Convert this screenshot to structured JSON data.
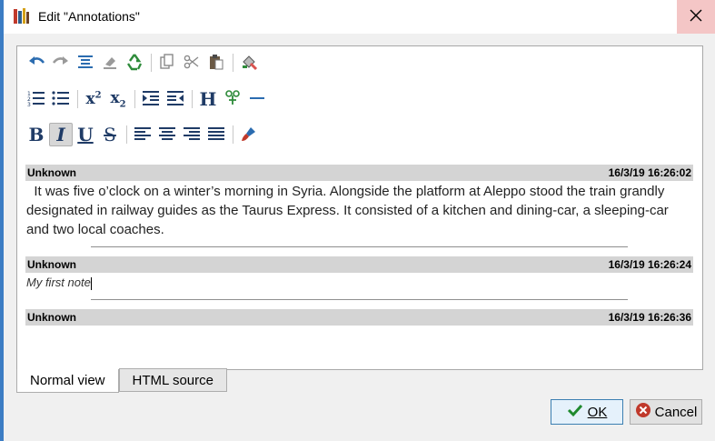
{
  "window": {
    "title": "Edit \"Annotations\""
  },
  "toolbar": {
    "row1": [
      "undo-icon",
      "redo-icon",
      "center-icon",
      "eraser-icon",
      "recycle-icon",
      "copy-icon",
      "cut-icon",
      "paste-icon",
      "clear-format-icon"
    ],
    "row2_labels": {
      "superscript": "x",
      "superscript_sup": "2",
      "subscript": "x",
      "subscript_sub": "2",
      "heading": "H"
    },
    "row3_labels": {
      "bold": "B",
      "italic": "I",
      "underline": "U",
      "strike": "S"
    },
    "accent_color": "#2b6cb0"
  },
  "notes": [
    {
      "author": "Unknown",
      "timestamp": "16/3/19 16:26:02",
      "text": "  It was five o’clock on a winter’s morning in Syria. Alongside the platform at Aleppo stood the train grandly designated in railway guides as the Taurus Express. It consisted of a kitchen and dining-car, a sleeping-car and two local coaches."
    },
    {
      "author": "Unknown",
      "timestamp": "16/3/19 16:26:24",
      "text": "My first note"
    },
    {
      "author": "Unknown",
      "timestamp": "16/3/19 16:26:36",
      "text": ""
    }
  ],
  "tabs": {
    "normal_view": "Normal view",
    "html_source": "HTML source",
    "selected": "normal_view"
  },
  "buttons": {
    "ok": "OK",
    "cancel": "Cancel"
  }
}
